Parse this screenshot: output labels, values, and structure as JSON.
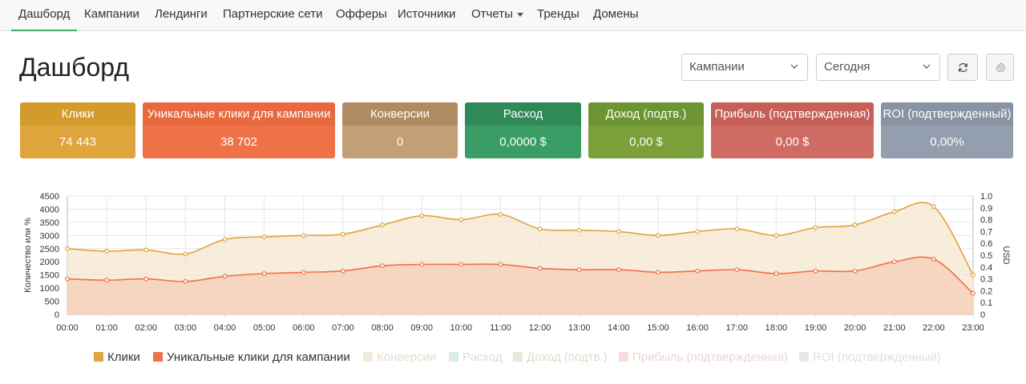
{
  "nav": {
    "items": [
      {
        "label": "Дашборд",
        "active": true
      },
      {
        "label": "Кампании"
      },
      {
        "label": "Лендинги"
      },
      {
        "label": "Партнерские сети"
      },
      {
        "label": "Офферы"
      },
      {
        "label": "Источники"
      },
      {
        "label": "Отчеты",
        "dropdown": true
      },
      {
        "label": "Тренды"
      },
      {
        "label": "Домены"
      }
    ]
  },
  "page": {
    "title": "Дашборд"
  },
  "filters": {
    "group_select": "Кампании",
    "period_select": "Сегодня",
    "refresh_icon": "refresh-icon",
    "settings_icon": "gear-icon"
  },
  "tiles": [
    {
      "label": "Клики",
      "value": "74 443",
      "head_color": "#d39a2c",
      "body_color": "#e0a43c"
    },
    {
      "label": "Уникальные клики для кампании",
      "value": "38 702",
      "head_color": "#e8693e",
      "body_color": "#ee7148"
    },
    {
      "label": "Конверсии",
      "value": "0",
      "head_color": "#b08a61",
      "body_color": "#c29f77"
    },
    {
      "label": "Расход",
      "value": "0,0000 $",
      "head_color": "#2f8a57",
      "body_color": "#3a9d66"
    },
    {
      "label": "Доход (подтв.)",
      "value": "0,00 $",
      "head_color": "#6d9432",
      "body_color": "#7b9f3b"
    },
    {
      "label": "Прибыль (подтвержденная)",
      "value": "0,00 $",
      "head_color": "#c65f58",
      "body_color": "#d06b64"
    },
    {
      "label": "ROI (подтвержденный)",
      "value": "0,00%",
      "head_color": "#8893a3",
      "body_color": "#939eae"
    }
  ],
  "chart_data": {
    "type": "area",
    "ylabel": "Количество или %",
    "y2label": "USD",
    "ylim": [
      0,
      4500
    ],
    "y_ticks": [
      0,
      500,
      1000,
      1500,
      2000,
      2500,
      3000,
      3500,
      4000,
      4500
    ],
    "y2lim": [
      0,
      1.0
    ],
    "y2_ticks": [
      "0",
      "0.1",
      "0.2",
      "0.3",
      "0.4",
      "0.5",
      "0.6",
      "0.7",
      "0.8",
      "0.9",
      "1.0"
    ],
    "grid": true,
    "legend_position": "bottom",
    "categories": [
      "00:00",
      "01:00",
      "02:00",
      "03:00",
      "04:00",
      "05:00",
      "06:00",
      "07:00",
      "08:00",
      "09:00",
      "10:00",
      "11:00",
      "12:00",
      "13:00",
      "14:00",
      "15:00",
      "16:00",
      "17:00",
      "18:00",
      "19:00",
      "20:00",
      "21:00",
      "22:00",
      "23:00"
    ],
    "series": [
      {
        "name": "Клики",
        "color": "#e0a43c",
        "fill": "#f5e6cf",
        "visible": true,
        "values": [
          2500,
          2400,
          2450,
          2300,
          2850,
          2950,
          3000,
          3050,
          3400,
          3750,
          3600,
          3800,
          3250,
          3200,
          3150,
          3000,
          3150,
          3250,
          3000,
          3300,
          3400,
          3900,
          4100,
          1500
        ]
      },
      {
        "name": "Уникальные клики для кампании",
        "color": "#ee7148",
        "fill": "#f6cdb8",
        "visible": true,
        "values": [
          1350,
          1300,
          1350,
          1250,
          1450,
          1550,
          1600,
          1650,
          1850,
          1900,
          1900,
          1900,
          1750,
          1700,
          1700,
          1600,
          1650,
          1700,
          1550,
          1650,
          1650,
          2000,
          2100,
          800
        ]
      },
      {
        "name": "Конверсии",
        "color": "#f4e8da",
        "visible": false
      },
      {
        "name": "Расход",
        "color": "#d8ecdf",
        "visible": false
      },
      {
        "name": "Доход (подтв.)",
        "color": "#e3ecd6",
        "visible": false
      },
      {
        "name": "Прибыль (подтвержденная)",
        "color": "#f7dcda",
        "visible": false
      },
      {
        "name": "ROI (подтвержденный)",
        "color": "#e4e7eb",
        "visible": false
      }
    ]
  }
}
